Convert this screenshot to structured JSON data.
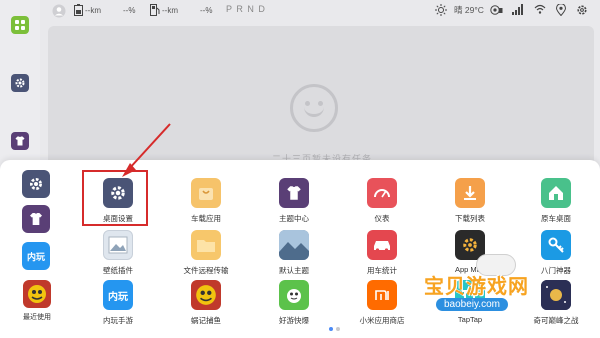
{
  "status_bar": {
    "range_a": "--km",
    "range_a_pct": "--%",
    "range_b": "--km",
    "range_b_pct": "--%",
    "gear": "P R N D",
    "weather": "晴 29°C"
  },
  "empty_state": {
    "message": "二十三页暂未设有任务"
  },
  "side_apps": [
    {
      "icon": "gear-icon",
      "label": ""
    },
    {
      "icon": "tshirt-icon",
      "label": ""
    },
    {
      "icon": "neiwan-icon",
      "label": "内玩"
    },
    {
      "icon": "game-icon",
      "label": "最近使用"
    }
  ],
  "apps": [
    {
      "label": "桌面设置",
      "icon": "gear-icon",
      "color": "#4a5476"
    },
    {
      "label": "车载应用",
      "icon": "bag-icon",
      "color": "#f6c36a"
    },
    {
      "label": "主题中心",
      "icon": "tshirt-icon",
      "color": "#5a3f76"
    },
    {
      "label": "仪表",
      "icon": "gauge-icon",
      "color": "#e8525a"
    },
    {
      "label": "下载列表",
      "icon": "download-icon",
      "color": "#f5a04a"
    },
    {
      "label": "原车桌面",
      "icon": "home-icon",
      "color": "#49c18b"
    },
    {
      "label": "壁纸插件",
      "icon": "picture-icon",
      "color": "#dfe6ee"
    },
    {
      "label": "文件远程传输",
      "icon": "folder-icon",
      "color": "#f7c76b"
    },
    {
      "label": "默认主题",
      "icon": "landscape-icon",
      "color": "#6a86a5"
    },
    {
      "label": "用车统计",
      "icon": "car-icon",
      "color": "#e4474f"
    },
    {
      "label": "App Man",
      "icon": "settings-box-icon",
      "color": "#2a2a2a"
    },
    {
      "label": "八门神器",
      "icon": "key-icon",
      "color": "#1b9ae4"
    },
    {
      "label": "内玩手游",
      "icon": "neiwan-icon",
      "color": "#2596f0"
    },
    {
      "label": "蜗记捕鱼",
      "icon": "game-icon",
      "color": "#c0392b"
    },
    {
      "label": "好游快爆",
      "icon": "frog-icon",
      "color": "#5cc24b"
    },
    {
      "label": "小米应用商店",
      "icon": "mi-icon",
      "color": "#ff6b00"
    },
    {
      "label": "TapTap",
      "icon": "taptap-icon",
      "color": "#28c5c6"
    },
    {
      "label": "奇可巅峰之战",
      "icon": "space-icon",
      "color": "#2b2f55"
    }
  ],
  "watermark": {
    "text": "宝贝游戏网",
    "url": "baobeiy.com"
  }
}
